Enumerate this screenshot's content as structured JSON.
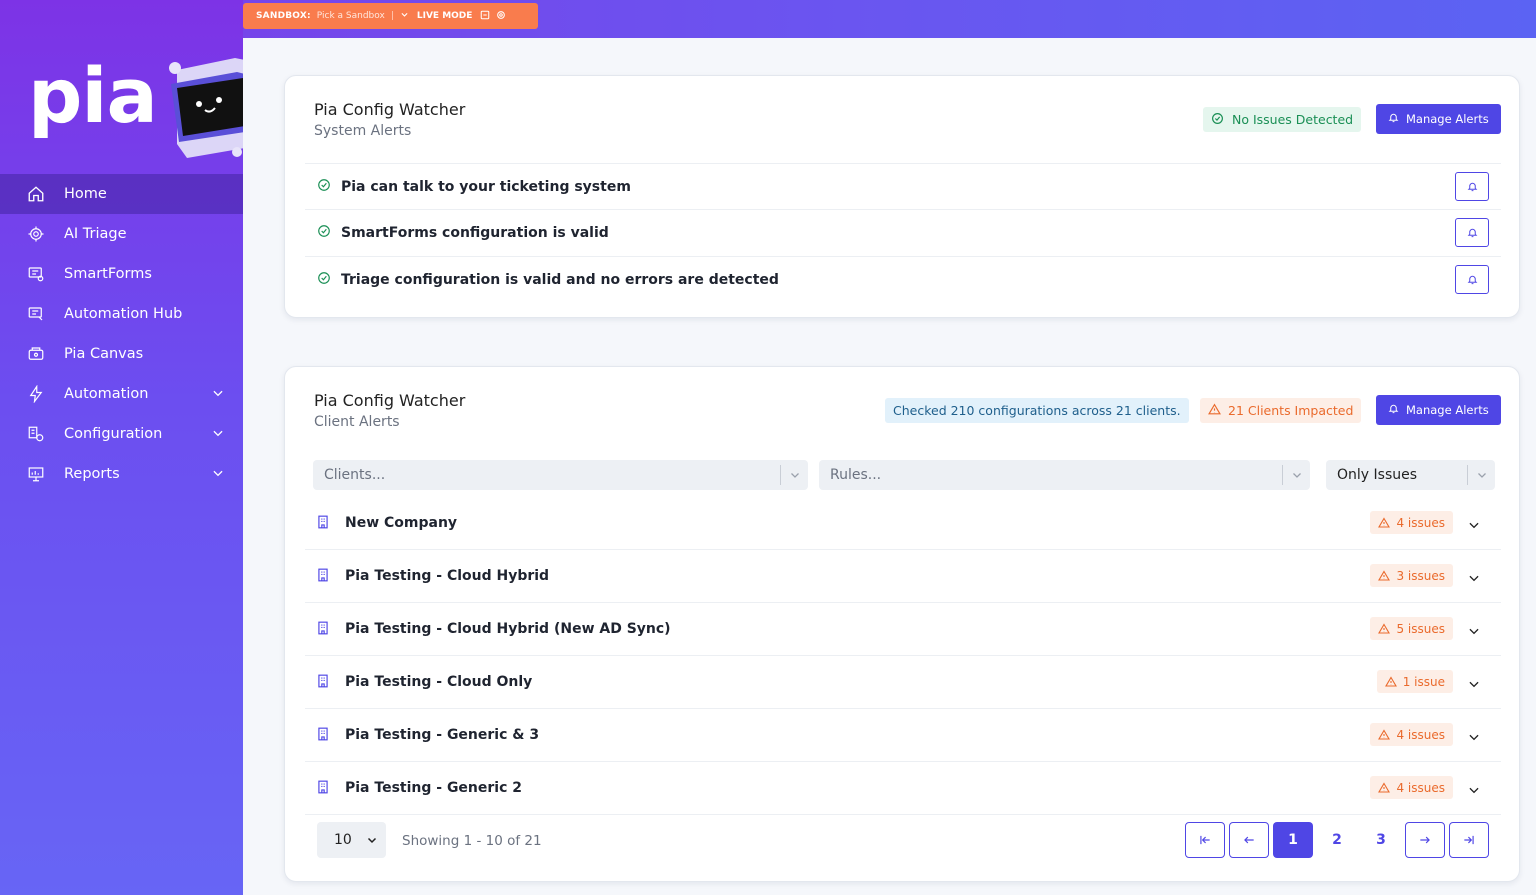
{
  "brand": {
    "logo_text": "pia"
  },
  "sandbox": {
    "label": "SANDBOX:",
    "pick": "Pick a Sandbox",
    "separator": "|",
    "mode": "LIVE MODE"
  },
  "nav": [
    {
      "label": "Home",
      "icon": "home-icon",
      "active": true
    },
    {
      "label": "AI Triage",
      "icon": "ai-chip-icon"
    },
    {
      "label": "SmartForms",
      "icon": "form-icon"
    },
    {
      "label": "Automation Hub",
      "icon": "hub-icon"
    },
    {
      "label": "Pia Canvas",
      "icon": "canvas-icon"
    },
    {
      "label": "Automation",
      "icon": "bolt-icon",
      "expandable": true
    },
    {
      "label": "Configuration",
      "icon": "config-icon",
      "expandable": true
    },
    {
      "label": "Reports",
      "icon": "reports-icon",
      "expandable": true
    }
  ],
  "system_card": {
    "title": "Pia Config Watcher",
    "subtitle": "System Alerts",
    "status": "No Issues Detected",
    "manage_label": "Manage Alerts",
    "alerts": [
      "Pia can talk to your ticketing system",
      "SmartForms configuration is valid",
      "Triage configuration is valid and no errors are detected"
    ]
  },
  "client_card": {
    "title": "Pia Config Watcher",
    "subtitle": "Client Alerts",
    "checked": "Checked 210 configurations across 21 clients.",
    "impacted": "21 Clients Impacted",
    "manage_label": "Manage Alerts",
    "filters": {
      "clients_placeholder": "Clients...",
      "rules_placeholder": "Rules...",
      "mode_value": "Only Issues"
    },
    "clients": [
      {
        "name": "New Company",
        "issues": "4 issues"
      },
      {
        "name": "Pia Testing - Cloud Hybrid",
        "issues": "3 issues"
      },
      {
        "name": "Pia Testing - Cloud Hybrid (New AD Sync)",
        "issues": "5 issues"
      },
      {
        "name": "Pia Testing - Cloud Only",
        "issues": "1 issue"
      },
      {
        "name": "Pia Testing - Generic & 3",
        "issues": "4 issues"
      },
      {
        "name": "Pia Testing - Generic 2",
        "issues": "4 issues"
      }
    ],
    "pagination": {
      "per_page": "10",
      "showing": "Showing 1 - 10 of 21",
      "pages": [
        "1",
        "2",
        "3"
      ],
      "current": "1"
    }
  },
  "colors": {
    "accent": "#4f46e5",
    "success": "#1a8f55",
    "warning": "#ea6a2c",
    "sandbox": "#f97c4d"
  }
}
